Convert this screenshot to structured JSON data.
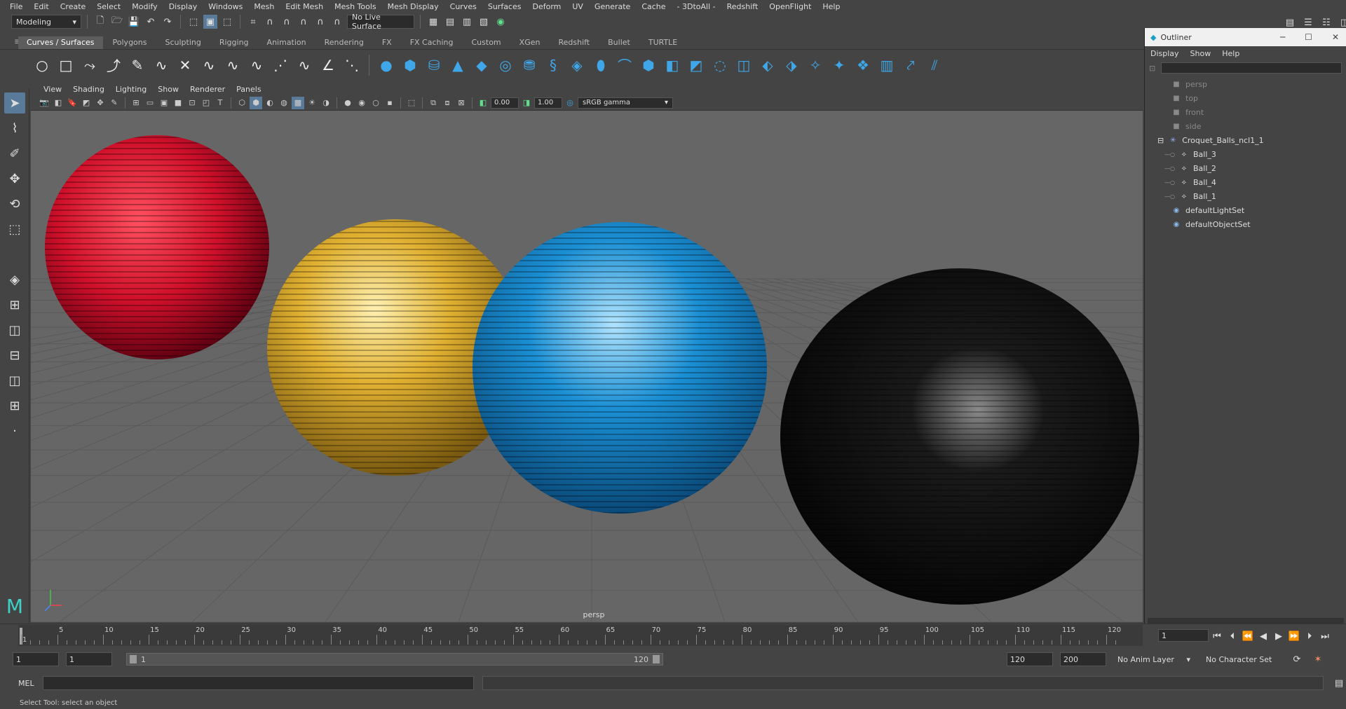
{
  "menubar": [
    "File",
    "Edit",
    "Create",
    "Select",
    "Modify",
    "Display",
    "Windows",
    "Mesh",
    "Edit Mesh",
    "Mesh Tools",
    "Mesh Display",
    "Curves",
    "Surfaces",
    "Deform",
    "UV",
    "Generate",
    "Cache",
    "- 3DtoAll -",
    "Redshift",
    "OpenFlight",
    "Help"
  ],
  "statusline": {
    "mode": "Modeling",
    "live_surface": "No Live Surface"
  },
  "shelf_tabs": [
    "Curves / Surfaces",
    "Polygons",
    "Sculpting",
    "Rigging",
    "Animation",
    "Rendering",
    "FX",
    "FX Caching",
    "Custom",
    "XGen",
    "Redshift",
    "Bullet",
    "TURTLE"
  ],
  "panel_menu": [
    "View",
    "Shading",
    "Lighting",
    "Show",
    "Renderer",
    "Panels"
  ],
  "panel_toolbar": {
    "exposure": "0.00",
    "gamma": "1.00",
    "color_space": "sRGB gamma"
  },
  "viewport": {
    "camera_label": "persp",
    "colors": {
      "background": "#666666",
      "grid": "#5a5a5a",
      "red_ball": "#d0102a",
      "yellow_ball": "#e0b030",
      "blue_ball": "#1a8fd4",
      "black_ball": "#0c0c0c"
    }
  },
  "outliner": {
    "title": "Outliner",
    "menu": [
      "Display",
      "Show",
      "Help"
    ],
    "items": [
      {
        "label": "persp",
        "depth": 1,
        "icon": "camera-icon",
        "dim": true
      },
      {
        "label": "top",
        "depth": 1,
        "icon": "camera-icon",
        "dim": true
      },
      {
        "label": "front",
        "depth": 1,
        "icon": "camera-icon",
        "dim": true
      },
      {
        "label": "side",
        "depth": 1,
        "icon": "camera-icon",
        "dim": true
      },
      {
        "label": "Croquet_Balls_ncl1_1",
        "depth": 1,
        "icon": "group-icon",
        "dim": false,
        "expanded": true
      },
      {
        "label": "Ball_3",
        "depth": 2,
        "icon": "mesh-icon",
        "dim": false
      },
      {
        "label": "Ball_2",
        "depth": 2,
        "icon": "mesh-icon",
        "dim": false
      },
      {
        "label": "Ball_4",
        "depth": 2,
        "icon": "mesh-icon",
        "dim": false
      },
      {
        "label": "Ball_1",
        "depth": 2,
        "icon": "mesh-icon",
        "dim": false
      },
      {
        "label": "defaultLightSet",
        "depth": 1,
        "icon": "set-icon",
        "dim": false
      },
      {
        "label": "defaultObjectSet",
        "depth": 1,
        "icon": "set-icon",
        "dim": false
      }
    ]
  },
  "timeline": {
    "labels": [
      "1",
      "5",
      "10",
      "15",
      "20",
      "25",
      "30",
      "35",
      "40",
      "45",
      "50",
      "55",
      "60",
      "65",
      "70",
      "75",
      "80",
      "85",
      "90",
      "95",
      "100",
      "105",
      "110",
      "115",
      "120"
    ],
    "current_frame": "1"
  },
  "range": {
    "start": "1",
    "anim_start": "1",
    "range_start_label": "1",
    "range_end_label": "120",
    "end": "120",
    "anim_end": "200",
    "anim_layer": "No Anim Layer",
    "character_set": "No Character Set"
  },
  "cmdline": {
    "label": "MEL"
  },
  "helpline": {
    "text": "Select Tool: select an object"
  }
}
